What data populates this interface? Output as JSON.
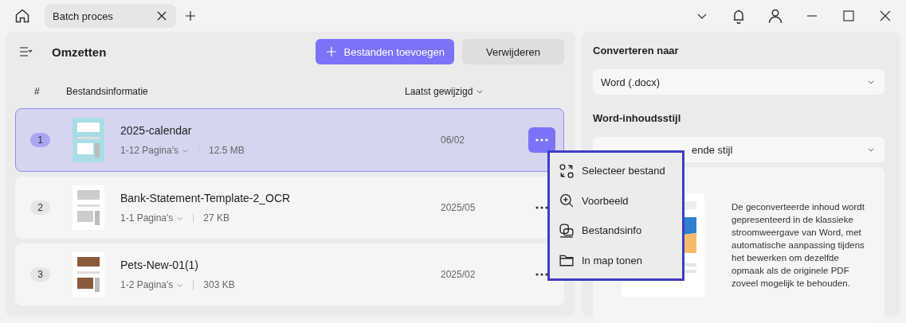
{
  "tabs": [
    {
      "label": "Batch proces",
      "selected": true
    }
  ],
  "toolbar": {
    "title": "Omzetten",
    "add_button": "Bestanden toevoegen",
    "remove_button": "Verwijderen"
  },
  "table": {
    "columns": [
      "#",
      "Bestandsinformatie",
      "Laatst gewijzigd"
    ],
    "rows": [
      {
        "index": "1",
        "name": "2025-calendar",
        "pages": "1-12 Pagina's",
        "size": "12.5 MB",
        "date": "06/02",
        "selected": true
      },
      {
        "index": "2",
        "name": "Bank-Statement-Template-2_OCR",
        "pages": "1-1 Pagina's",
        "size": "27 KB",
        "date": "2025/05",
        "selected": false
      },
      {
        "index": "3",
        "name": "Pets-New-01(1)",
        "pages": "1-2 Pagina's",
        "size": "303 KB",
        "date": "2025/02",
        "selected": false
      }
    ]
  },
  "context_menu": [
    {
      "kind": "select",
      "label": "Selecteer bestand"
    },
    {
      "kind": "preview",
      "label": "Voorbeeld"
    },
    {
      "kind": "info",
      "label": "Bestandsinfo"
    },
    {
      "kind": "folder",
      "label": "In map tonen"
    }
  ],
  "settings": {
    "convert_label": "Converteren naar",
    "format": "Word (.docx)",
    "style_label": "Word-inhoudsstijl",
    "style_value": "ende stijl",
    "description": "De geconverteerde inhoud wordt gepresenteerd in de klassieke stroomweergave van Word, met automatische aanpassing tijdens het bewerken om dezelfde opmaak als de originele PDF zoveel mogelijk te behouden."
  }
}
